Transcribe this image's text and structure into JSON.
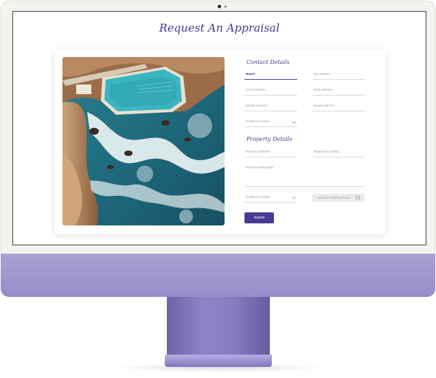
{
  "page": {
    "title": "Request An Appraisal"
  },
  "contact": {
    "heading": "Contact Details",
    "name": "Name*",
    "address": "My address",
    "home": "Home Number",
    "work": "Work Number",
    "mobile": "Mobile Number*",
    "email": "Email Address*",
    "preferred": "Preffered Contact"
  },
  "property": {
    "heading": "Property Details",
    "address": "Property Address*",
    "reason": "Reason for Selling",
    "description": "Property Description",
    "preferred": "Preffered Contact",
    "upload": "Upload Property Photos"
  },
  "actions": {
    "submit": "Submit"
  },
  "icons": {
    "upload": "image-icon",
    "dropdown": "chevron-down-icon"
  },
  "colors": {
    "accent": "#4a3993",
    "imac_chin": "#a8a2d4"
  }
}
